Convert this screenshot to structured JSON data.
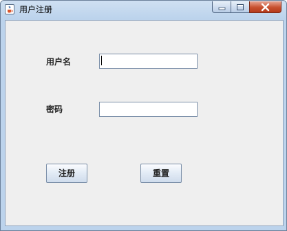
{
  "window": {
    "title": "用户注册",
    "icon": "java-cup-icon",
    "controls": {
      "minimize": "minimize-icon",
      "maximize": "maximize-icon",
      "close": "close-icon"
    }
  },
  "form": {
    "username_label": "用户名",
    "username_value": "",
    "password_label": "密码",
    "password_value": ""
  },
  "buttons": {
    "register_label": "注册",
    "reset_label": "重置"
  },
  "colors": {
    "titlebar": "#bcd3ec",
    "content_bg": "#efefef",
    "close_button": "#c7502f"
  }
}
